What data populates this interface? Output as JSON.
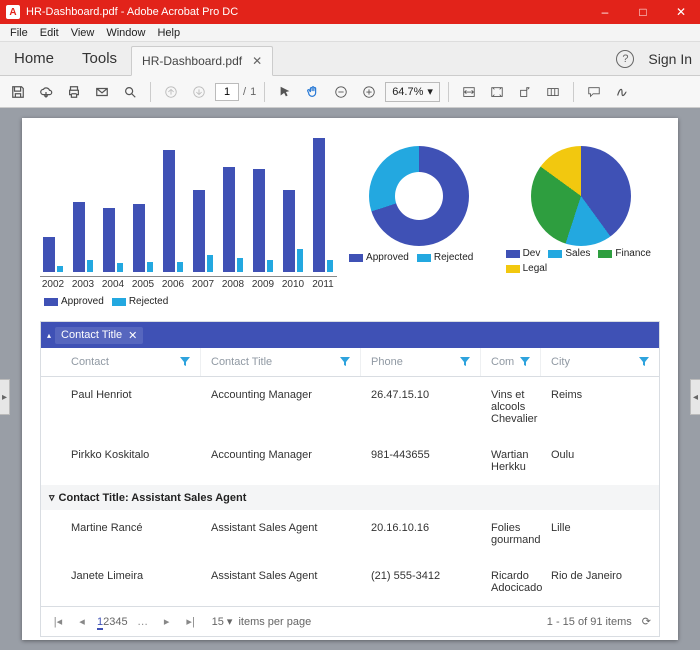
{
  "window": {
    "title": "HR-Dashboard.pdf - Adobe Acrobat Pro DC",
    "minimize_icon": "minimize-icon",
    "maximize_icon": "maximize-icon",
    "close_icon": "close-icon"
  },
  "menu": {
    "items": [
      "File",
      "Edit",
      "View",
      "Window",
      "Help"
    ]
  },
  "tabs": {
    "home": "Home",
    "tools": "Tools",
    "file": "HR-Dashboard.pdf",
    "help_icon": "help-icon",
    "sign_in": "Sign In"
  },
  "toolbar": {
    "page_current": "1",
    "page_sep": "/",
    "page_total": "1",
    "zoom": "64.7%"
  },
  "chart_data": [
    {
      "type": "bar",
      "categories": [
        "2002",
        "2003",
        "2004",
        "2005",
        "2006",
        "2007",
        "2008",
        "2009",
        "2010",
        "2011"
      ],
      "series": [
        {
          "name": "Approved",
          "color": "#3f51b5",
          "values": [
            30,
            60,
            55,
            58,
            105,
            70,
            90,
            88,
            70,
            115
          ]
        },
        {
          "name": "Rejected",
          "color": "#23a8e0",
          "values": [
            5,
            10,
            8,
            9,
            9,
            15,
            12,
            10,
            20,
            10
          ]
        }
      ],
      "ylim": [
        0,
        120
      ]
    },
    {
      "type": "pie",
      "donut": true,
      "series": [
        {
          "name": "Approved",
          "color": "#3f51b5",
          "value": 70
        },
        {
          "name": "Rejected",
          "color": "#23a8e0",
          "value": 30
        }
      ]
    },
    {
      "type": "pie",
      "donut": false,
      "series": [
        {
          "name": "Dev",
          "color": "#3f51b5",
          "value": 40
        },
        {
          "name": "Sales",
          "color": "#23a8e0",
          "value": 15
        },
        {
          "name": "Finance",
          "color": "#2e9e3f",
          "value": 30
        },
        {
          "name": "Legal",
          "color": "#f2c80f",
          "value": 15
        }
      ]
    }
  ],
  "grid": {
    "group_field": "Contact Title",
    "columns": {
      "contact": "Contact",
      "title": "Contact Title",
      "phone": "Phone",
      "com": "Com",
      "city": "City"
    },
    "groups": [
      {
        "label": "",
        "rows": [
          {
            "contact": "Paul Henriot",
            "title": "Accounting Manager",
            "phone": "26.47.15.10",
            "com": "Vins et alcools Chevalier",
            "city": "Reims"
          },
          {
            "contact": "Pirkko Koskitalo",
            "title": "Accounting Manager",
            "phone": "981-443655",
            "com": "Wartian Herkku",
            "city": "Oulu"
          }
        ]
      },
      {
        "label": "Contact Title: Assistant Sales Agent",
        "rows": [
          {
            "contact": "Martine Rancé",
            "title": "Assistant Sales Agent",
            "phone": "20.16.10.16",
            "com": "Folies gourmand",
            "city": "Lille"
          },
          {
            "contact": "Janete Limeira",
            "title": "Assistant Sales Agent",
            "phone": "(21) 555-3412",
            "com": "Ricardo Adocicado",
            "city": "Rio de Janeiro"
          }
        ]
      }
    ],
    "pager": {
      "pages": [
        "1",
        "2",
        "3",
        "4",
        "5"
      ],
      "more": "…",
      "current": 0,
      "page_size": "15",
      "page_size_label": "items per page",
      "summary": "1 - 15 of 91 items"
    }
  }
}
